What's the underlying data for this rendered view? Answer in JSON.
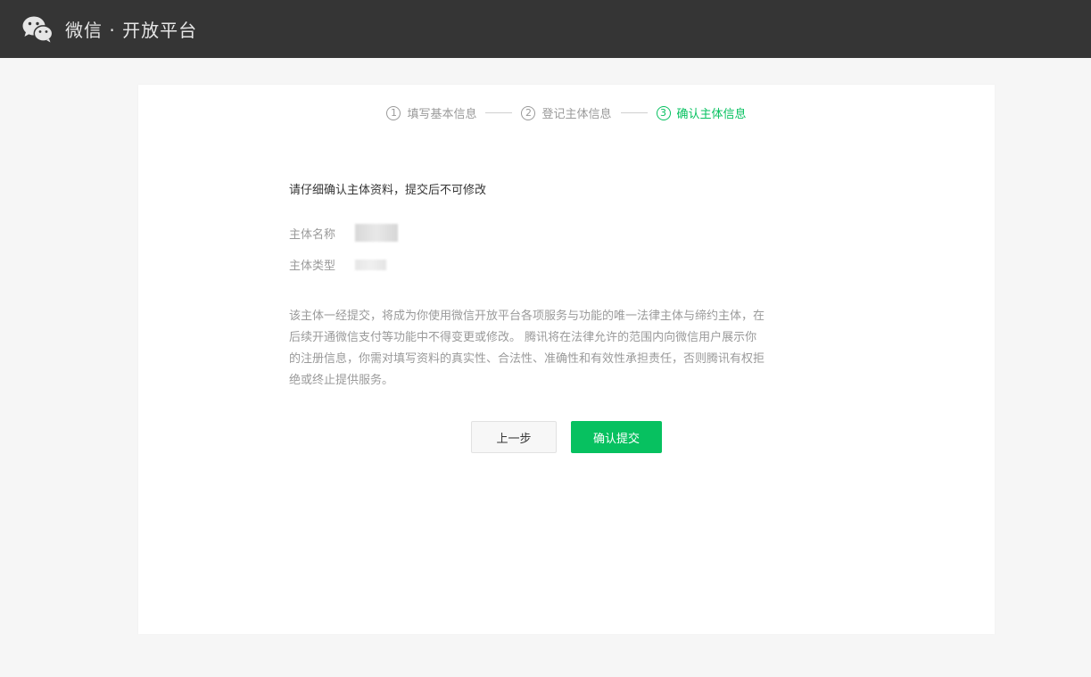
{
  "header": {
    "brand": "微信 · 开放平台",
    "logo_icon": "wechat-logo-icon"
  },
  "steps": [
    {
      "number": "1",
      "label": "填写基本信息",
      "active": false
    },
    {
      "number": "2",
      "label": "登记主体信息",
      "active": false
    },
    {
      "number": "3",
      "label": "确认主体信息",
      "active": true
    }
  ],
  "content": {
    "title": "请仔细确认主体资料，提交后不可修改",
    "fields": [
      {
        "label": "主体名称"
      },
      {
        "label": "主体类型"
      }
    ],
    "notice": "该主体一经提交，将成为你使用微信开放平台各项服务与功能的唯一法律主体与缔约主体，在后续开通微信支付等功能中不得变更或修改。 腾讯将在法律允许的范围内向微信用户展示你的注册信息，你需对填写资料的真实性、合法性、准确性和有效性承担责任，否则腾讯有权拒绝或终止提供服务。"
  },
  "buttons": {
    "prev": "上一步",
    "submit": "确认提交"
  },
  "colors": {
    "accent": "#07c160",
    "header_bg": "#353535",
    "page_bg": "#f6f6f6"
  }
}
